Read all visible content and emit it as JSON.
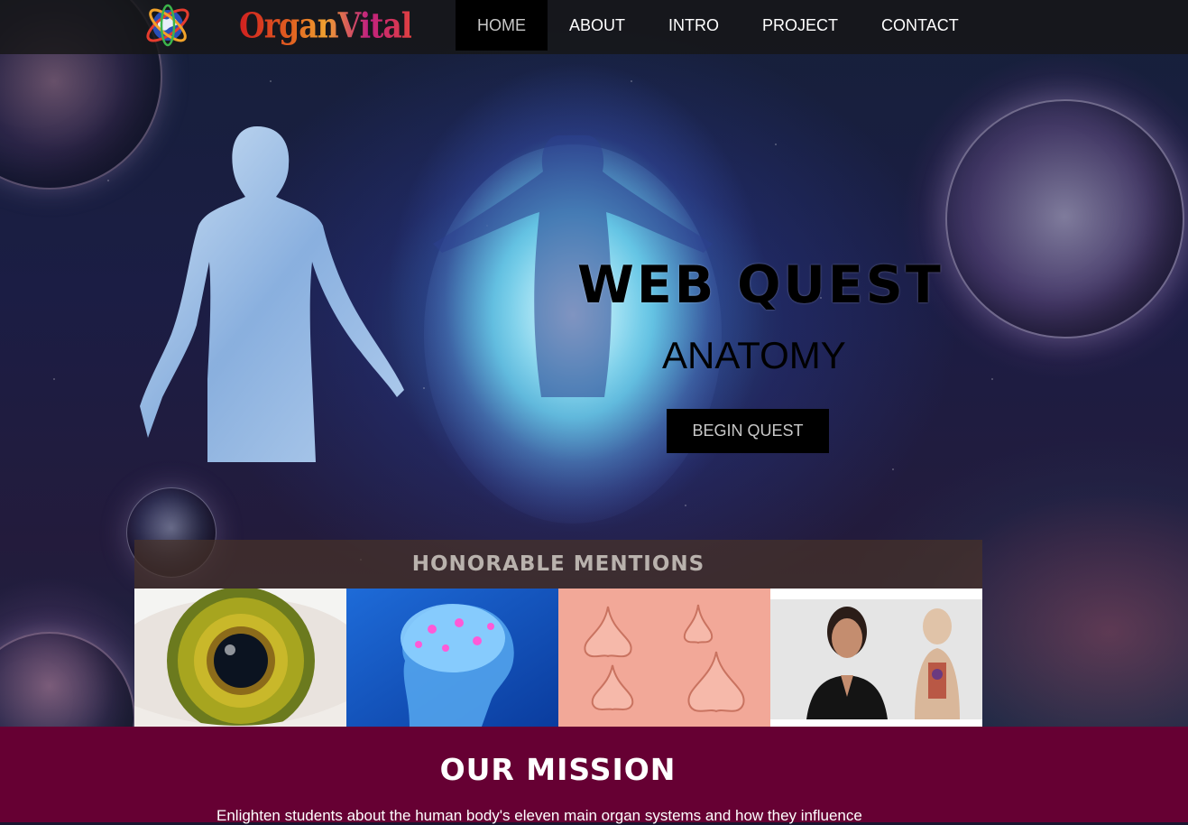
{
  "brand": {
    "logo_icon": "globe-orbit-icon",
    "name": "OrganVital"
  },
  "nav": {
    "items": [
      {
        "label": "HOME",
        "active": true
      },
      {
        "label": "ABOUT",
        "active": false
      },
      {
        "label": "INTRO",
        "active": false
      },
      {
        "label": "PROJECT",
        "active": false
      },
      {
        "label": "CONTACT",
        "active": false
      }
    ]
  },
  "hero": {
    "title": "WEB QUEST",
    "subtitle": "ANATOMY",
    "cta_label": "BEGIN QUEST"
  },
  "mentions": {
    "title": "HONORABLE MENTIONS",
    "images": [
      "eye",
      "brain",
      "noses",
      "anatomy-teacher"
    ]
  },
  "mission": {
    "title": "OUR MISSION",
    "text": "Enlighten students about the human body's eleven main organ systems and how they influence"
  },
  "colors": {
    "nav_bg": "#161616",
    "nav_active_bg": "#000000",
    "mission_bg": "#660033",
    "button_bg": "#000000",
    "button_text": "#c8c8c8"
  }
}
